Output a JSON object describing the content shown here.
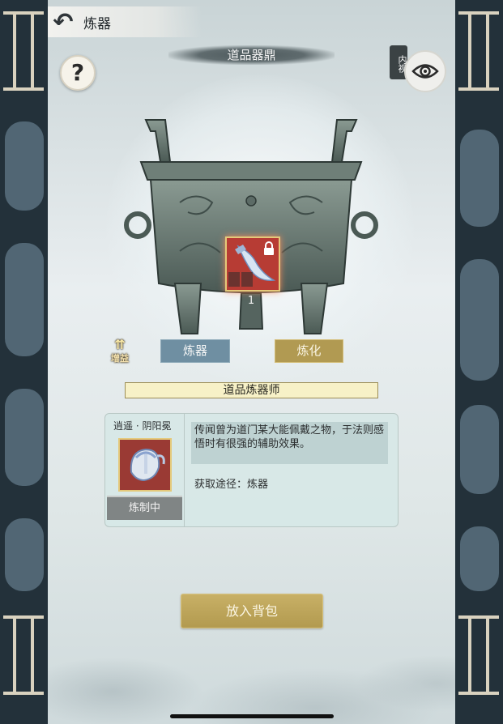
{
  "header": {
    "back_icon": "back-arrow-icon",
    "title": "炼器"
  },
  "ding": {
    "title": "道品器鼎"
  },
  "help": {
    "label": "?",
    "icon": "question-icon"
  },
  "inner_view": {
    "label": "内视",
    "icon": "eye-icon"
  },
  "slot": {
    "count": "1",
    "icon": "blade-weapon-icon",
    "lock_icon": "lock-icon",
    "colors": {
      "bg": "#b73c34",
      "border": "#e4c97a"
    }
  },
  "boost": {
    "label": "增益",
    "icon": "up-arrows-icon"
  },
  "tabs": {
    "refine": "炼器",
    "transform": "炼化"
  },
  "craftsman": {
    "title": "道品炼器师"
  },
  "item": {
    "name": "逍遥 · 阴阳冕",
    "icon": "helmet-icon",
    "status": "炼制中",
    "description": "传闻曾为道门某大能佩戴之物，于法则感悟时有很强的辅助效果。",
    "source": "获取途径：炼器"
  },
  "actions": {
    "put_in_bag": "放入背包"
  },
  "colors": {
    "accent_gold": "#b19a52",
    "accent_blue": "#6f8fa2",
    "side_dark": "#23313a"
  }
}
